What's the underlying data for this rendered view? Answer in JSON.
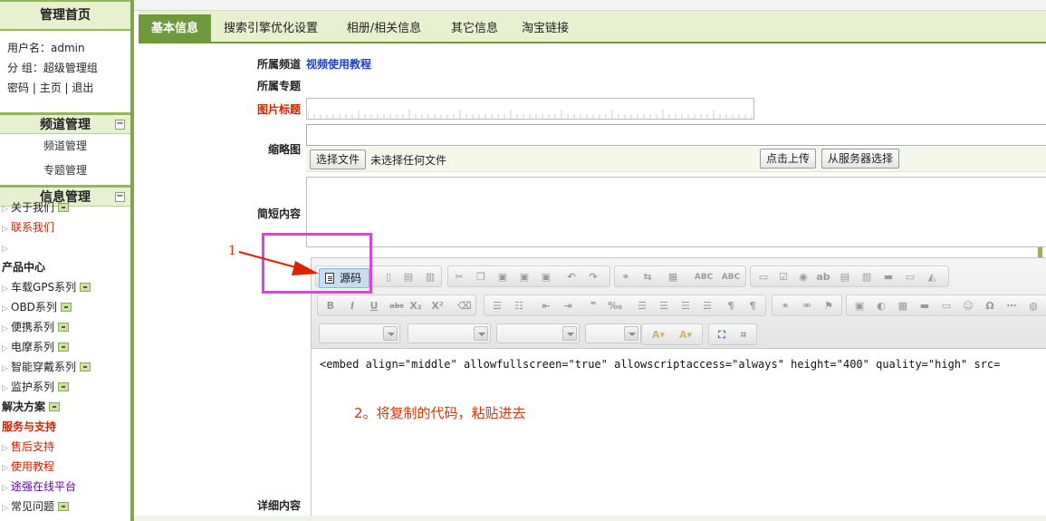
{
  "sidebar": {
    "header": "管理首页",
    "user": {
      "username_label": "用户名：admin",
      "group_label": "分   组：超级管理组",
      "links": [
        "密码",
        "主页",
        "退出"
      ]
    },
    "channel_section": {
      "title": "频道管理",
      "collapse": "−",
      "items": [
        "频道管理",
        "专题管理"
      ]
    },
    "info_section": {
      "title": "信息管理",
      "collapse": "−"
    },
    "tree": [
      {
        "label": "关于我们",
        "arrow": "▷",
        "color": "normal",
        "plus": true
      },
      {
        "label": "联系我们",
        "arrow": "▷",
        "color": "red",
        "plus": false
      },
      {
        "label": "",
        "arrow": "▷",
        "color": "normal",
        "plus": false
      },
      {
        "label": "产品中心",
        "arrow": "",
        "color": "bold",
        "plus": false
      },
      {
        "label": "车载GPS系列",
        "arrow": "▷",
        "color": "normal",
        "plus": true
      },
      {
        "label": "OBD系列",
        "arrow": "▷",
        "color": "normal",
        "plus": true
      },
      {
        "label": "便携系列",
        "arrow": "▷",
        "color": "normal",
        "plus": true
      },
      {
        "label": "电摩系列",
        "arrow": "▷",
        "color": "normal",
        "plus": true
      },
      {
        "label": "智能穿戴系列",
        "arrow": "▷",
        "color": "normal",
        "plus": true
      },
      {
        "label": "监护系列",
        "arrow": "▷",
        "color": "normal",
        "plus": true
      },
      {
        "label": "解决方案",
        "arrow": "",
        "color": "bold",
        "plus": true
      },
      {
        "label": "服务与支持",
        "arrow": "",
        "color": "redbold",
        "plus": false
      },
      {
        "label": "售后支持",
        "arrow": "▷",
        "color": "red",
        "plus": false
      },
      {
        "label": "使用教程",
        "arrow": "▷",
        "color": "red",
        "plus": false
      },
      {
        "label": "途强在线平台",
        "arrow": "▷",
        "color": "purple",
        "plus": false
      },
      {
        "label": "常见问题",
        "arrow": "▷",
        "color": "normal",
        "plus": true
      }
    ]
  },
  "tabs": [
    "基本信息",
    "搜索引擎优化设置",
    "相册/相关信息",
    "其它信息",
    "淘宝链接"
  ],
  "form": {
    "channel_label": "所属频道",
    "channel_value": "视频使用教程",
    "topic_label": "所属专题",
    "title_label": "图片标题",
    "thumb_label": "缩略图",
    "choose_file_button": "选择文件",
    "file_status": "未选择任何文件",
    "upload_button": "点击上传",
    "server_button": "从服务器选择",
    "short_label": "简短内容",
    "detail_label": "详细内容"
  },
  "editor": {
    "source_button": "源码",
    "code": "<embed align=\"middle\" allowfullscreen=\"true\" allowscriptaccess=\"always\" height=\"400\" quality=\"high\" src=",
    "toolbar_row1": [
      "↶",
      "↷"
    ],
    "icons_row2": [
      "B",
      "I",
      "U",
      "abc",
      "X₂",
      "X²"
    ]
  },
  "annotations": {
    "step1": "1",
    "step2": "2。将复制的代码，粘贴进去"
  },
  "colors": {
    "accent": "#6f9a3c",
    "sidebar_bg": "#e7f1cf",
    "highlight": "#e040e0",
    "note": "#dd3300"
  }
}
